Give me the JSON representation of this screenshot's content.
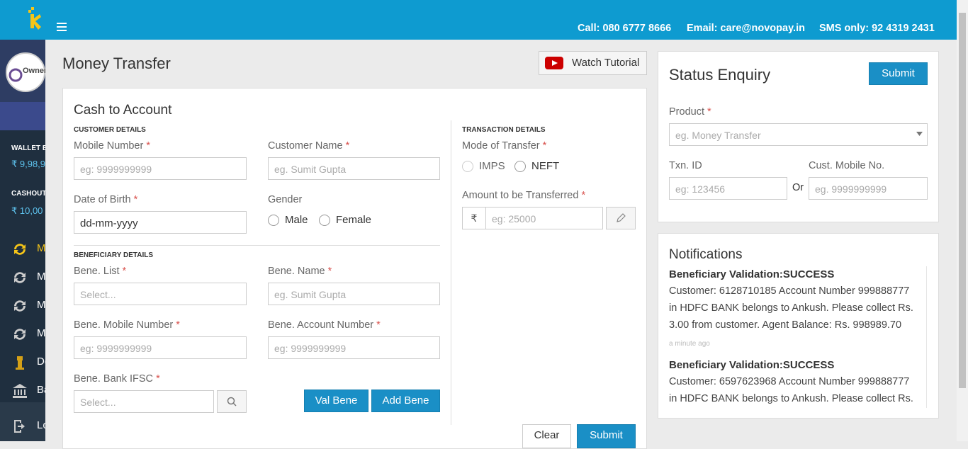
{
  "header": {
    "call": "Call: 080 6777 8666",
    "email": "Email: care@novopay.in",
    "sms": "SMS only: 92 4319 2431"
  },
  "sidebar": {
    "avatar_text": "Owner",
    "wallet_label": "WALLET B",
    "wallet_value": "₹ 9,98,9",
    "cashout_label": "CASHOUT",
    "cashout_value": "₹ 10,00",
    "items": [
      {
        "label": "M",
        "icon": "refresh-icon"
      },
      {
        "label": "M",
        "icon": "refresh-icon"
      },
      {
        "label": "M",
        "icon": "refresh-icon"
      },
      {
        "label": "M",
        "icon": "refresh-icon"
      },
      {
        "label": "De",
        "icon": "emblem-icon"
      },
      {
        "label": "Ba",
        "icon": "bank-icon"
      },
      {
        "label": "Lo",
        "icon": "logout-icon"
      }
    ]
  },
  "page": {
    "title": "Money Transfer",
    "watch_tutorial": "Watch Tutorial"
  },
  "form": {
    "heading": "Cash to Account",
    "customer_details": "CUSTOMER DETAILS",
    "mobile_label": "Mobile Number",
    "mobile_placeholder": "eg: 9999999999",
    "name_label": "Customer Name",
    "name_placeholder": "eg. Sumit Gupta",
    "dob_label": "Date of Birth",
    "dob_value": "dd-mm-yyyy",
    "gender_label": "Gender",
    "gender_male": "Male",
    "gender_female": "Female",
    "beneficiary_details": "BENEFICIARY DETAILS",
    "bene_list_label": "Bene. List",
    "bene_list_placeholder": "Select...",
    "bene_name_label": "Bene. Name",
    "bene_name_placeholder": "eg. Sumit Gupta",
    "bene_mobile_label": "Bene. Mobile Number",
    "bene_mobile_placeholder": "eg: 9999999999",
    "bene_account_label": "Bene. Account Number",
    "bene_account_placeholder": "eg: 9999999999",
    "bene_ifsc_label": "Bene. Bank IFSC",
    "bene_ifsc_placeholder": "Select...",
    "val_bene": "Val Bene",
    "add_bene": "Add Bene",
    "transaction_details": "TRANSACTION DETAILS",
    "mode_label": "Mode of Transfer",
    "mode_imps": "IMPS",
    "mode_neft": "NEFT",
    "amount_label": "Amount to be Transferred",
    "amount_prefix": "₹",
    "amount_placeholder": "eg: 25000",
    "clear": "Clear",
    "submit": "Submit",
    "required_mark": "*"
  },
  "status_enquiry": {
    "heading": "Status Enquiry",
    "submit": "Submit",
    "product_label": "Product",
    "product_placeholder": "eg. Money Transfer",
    "txn_label": "Txn. ID",
    "txn_placeholder": "eg: 123456",
    "or": "Or",
    "cust_mobile_label": "Cust. Mobile No.",
    "cust_mobile_placeholder": "eg. 9999999999"
  },
  "notifications": {
    "heading": "Notifications",
    "items": [
      {
        "title": "Beneficiary Validation:SUCCESS",
        "text": "Customer: 6128710185 Account Number 999888777 in HDFC BANK belongs to Ankush. Please collect Rs. 3.00 from customer. Agent Balance: Rs. 998989.70",
        "time": "a minute ago"
      },
      {
        "title": "Beneficiary Validation:SUCCESS",
        "text": "Customer: 6597623968 Account Number 999888777 in HDFC BANK belongs to Ankush. Please collect Rs.",
        "time": ""
      }
    ]
  },
  "colors": {
    "header": "#0e9bd0",
    "sidebar": "#1f2f3f",
    "primary_button": "#1a8fc6",
    "required": "#d9534f",
    "accent_icon": "#f5c518"
  }
}
